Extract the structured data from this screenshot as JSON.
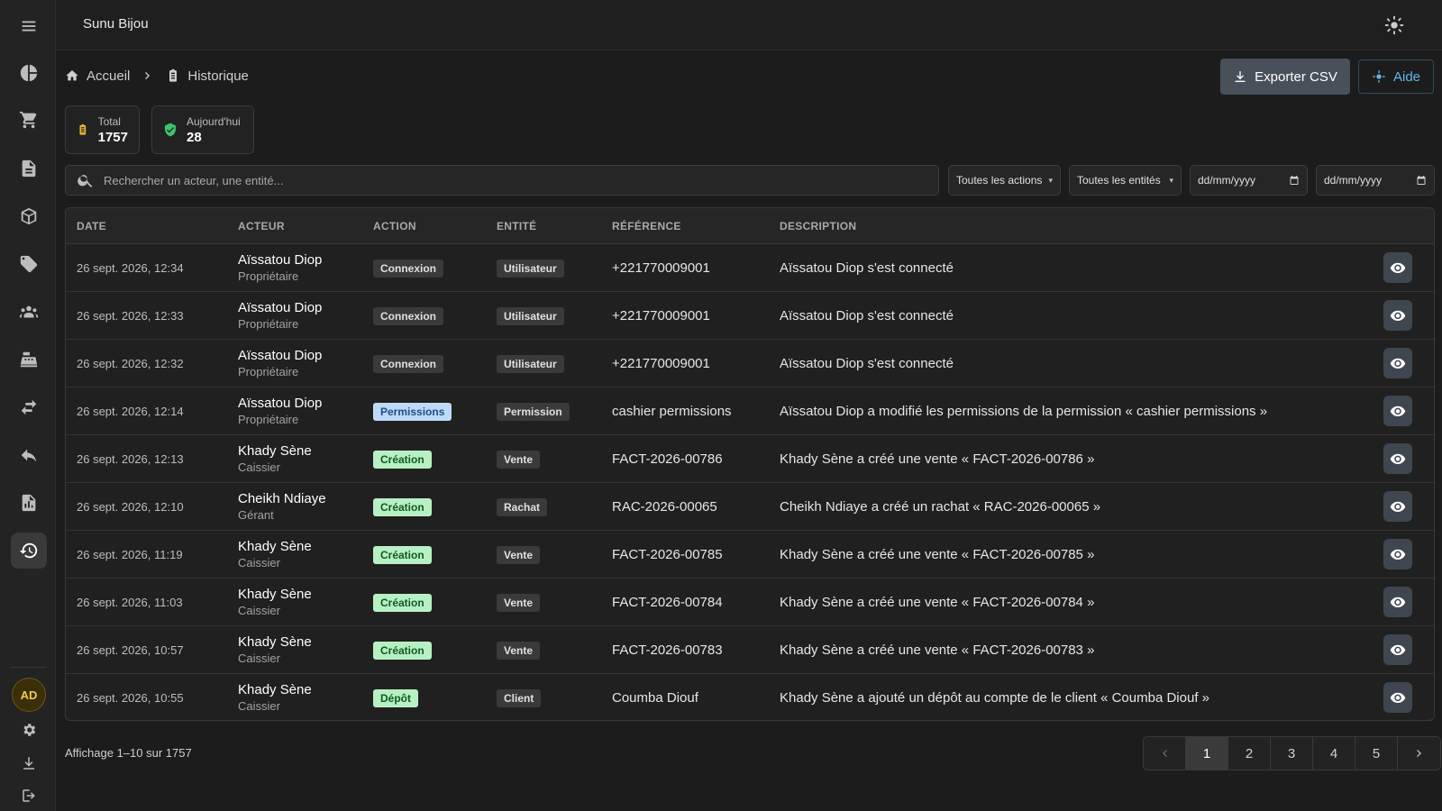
{
  "app": {
    "title": "Sunu Bijou"
  },
  "breadcrumb": {
    "home": "Accueil",
    "current": "Historique"
  },
  "actions": {
    "export_label": "Exporter CSV",
    "help_label": "Aide"
  },
  "stats": {
    "total_label": "Total",
    "total_value": "1757",
    "today_label": "Aujourd'hui",
    "today_value": "28"
  },
  "user": {
    "initials": "AD"
  },
  "filters": {
    "search_placeholder": "Rechercher un acteur, une entité...",
    "actions_selected": "Toutes les actions",
    "entities_selected": "Toutes les entités",
    "date_from_placeholder": "dd/mm/yyyy",
    "date_to_placeholder": "dd/mm/yyyy"
  },
  "table": {
    "columns": [
      "DATE",
      "ACTEUR",
      "ACTION",
      "ENTITÉ",
      "RÉFÉRENCE",
      "DESCRIPTION"
    ],
    "rows": [
      {
        "date": "26 sept. 2026, 12:34",
        "actor": "Aïssatou Diop",
        "role": "Propriétaire",
        "action": "Connexion",
        "entity": "Utilisateur",
        "reference": "+221770009001",
        "description": "Aïssatou Diop s'est connecté"
      },
      {
        "date": "26 sept. 2026, 12:33",
        "actor": "Aïssatou Diop",
        "role": "Propriétaire",
        "action": "Connexion",
        "entity": "Utilisateur",
        "reference": "+221770009001",
        "description": "Aïssatou Diop s'est connecté"
      },
      {
        "date": "26 sept. 2026, 12:32",
        "actor": "Aïssatou Diop",
        "role": "Propriétaire",
        "action": "Connexion",
        "entity": "Utilisateur",
        "reference": "+221770009001",
        "description": "Aïssatou Diop s'est connecté"
      },
      {
        "date": "26 sept. 2026, 12:14",
        "actor": "Aïssatou Diop",
        "role": "Propriétaire",
        "action": "Permissions",
        "entity": "Permission",
        "reference": "cashier permissions",
        "description": "Aïssatou Diop a modifié les permissions de la permission « cashier permissions »"
      },
      {
        "date": "26 sept. 2026, 12:13",
        "actor": "Khady Sène",
        "role": "Caissier",
        "action": "Création",
        "entity": "Vente",
        "reference": "FACT-2026-00786",
        "description": "Khady Sène a créé une vente « FACT-2026-00786 »"
      },
      {
        "date": "26 sept. 2026, 12:10",
        "actor": "Cheikh Ndiaye",
        "role": "Gérant",
        "action": "Création",
        "entity": "Rachat",
        "reference": "RAC-2026-00065",
        "description": "Cheikh Ndiaye a créé un rachat « RAC-2026-00065 »"
      },
      {
        "date": "26 sept. 2026, 11:19",
        "actor": "Khady Sène",
        "role": "Caissier",
        "action": "Création",
        "entity": "Vente",
        "reference": "FACT-2026-00785",
        "description": "Khady Sène a créé une vente « FACT-2026-00785 »"
      },
      {
        "date": "26 sept. 2026, 11:03",
        "actor": "Khady Sène",
        "role": "Caissier",
        "action": "Création",
        "entity": "Vente",
        "reference": "FACT-2026-00784",
        "description": "Khady Sène a créé une vente « FACT-2026-00784 »"
      },
      {
        "date": "26 sept. 2026, 10:57",
        "actor": "Khady Sène",
        "role": "Caissier",
        "action": "Création",
        "entity": "Vente",
        "reference": "FACT-2026-00783",
        "description": "Khady Sène a créé une vente « FACT-2026-00783 »"
      },
      {
        "date": "26 sept. 2026, 10:55",
        "actor": "Khady Sène",
        "role": "Caissier",
        "action": "Dépôt",
        "entity": "Client",
        "reference": "Coumba Diouf",
        "description": "Khady Sène a ajouté un dépôt au compte de le client « Coumba Diouf »"
      }
    ]
  },
  "pagination": {
    "summary": "Affichage 1–10 sur 1757",
    "pages": [
      "1",
      "2",
      "3",
      "4",
      "5"
    ],
    "current": "1"
  },
  "colors": {
    "accent_blue": "#5fb8ee",
    "badge_green_bg": "#b8f0c4",
    "badge_blue_bg": "#bfdaf7",
    "avatar_gold": "#f2c94c"
  }
}
